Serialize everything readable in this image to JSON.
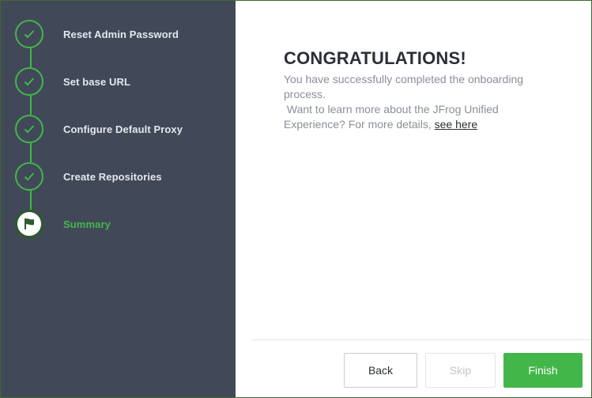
{
  "steps": [
    {
      "label": "Reset Admin Password",
      "state": "done"
    },
    {
      "label": "Set base URL",
      "state": "done"
    },
    {
      "label": "Configure Default Proxy",
      "state": "done"
    },
    {
      "label": "Create Repositories",
      "state": "done"
    },
    {
      "label": "Summary",
      "state": "active"
    }
  ],
  "content": {
    "title": "CONGRATULATIONS!",
    "line1": "You have successfully completed the onboarding process.",
    "line2_prefix": " Want to learn more about the JFrog Unified Experience? For more details, ",
    "link": "see here"
  },
  "buttons": {
    "back": "Back",
    "skip": "Skip",
    "finish": "Finish"
  },
  "colors": {
    "sidebar": "#414959",
    "accent": "#43b64a",
    "title": "#2b2f37",
    "muted": "#8b8f98"
  }
}
